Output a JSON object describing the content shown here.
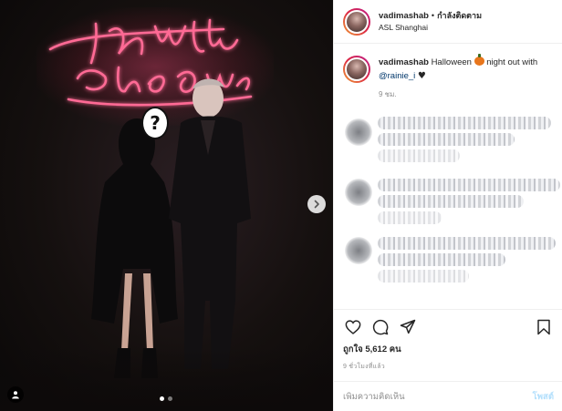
{
  "photo": {
    "neon_text": "I'm with the Owner",
    "face_mark": "?",
    "dots": [
      true,
      false
    ]
  },
  "header": {
    "username": "vadimashab",
    "separator": "•",
    "follow_label": "กำลังติดตาม",
    "location": "ASL Shanghai"
  },
  "caption": {
    "username": "vadimashab",
    "text_before": "Halloween",
    "text_middle": "night out with",
    "mention": "@rainie_i",
    "time": "9 ชม."
  },
  "actions": {
    "icons": [
      "heart-icon",
      "comment-icon",
      "share-icon",
      "bookmark-icon"
    ],
    "likes_label": "ถูกใจ 5,612 คน",
    "time_ago": "9 ชั่วโมงที่แล้ว"
  },
  "comment_box": {
    "placeholder": "เพิ่มความคิดเห็น",
    "post_label": "โพสต์"
  },
  "colors": {
    "neon": "#ff4d7a",
    "link": "#00376b",
    "post_disabled": "#b2dffc",
    "muted": "#8e8e8e"
  }
}
